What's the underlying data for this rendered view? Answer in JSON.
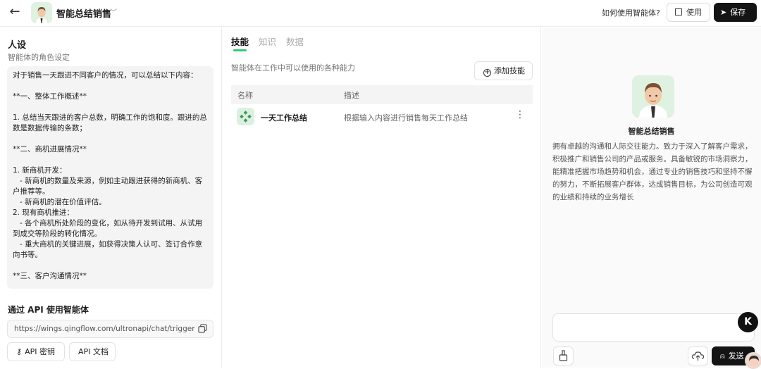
{
  "header": {
    "title": "智能总结销售",
    "howto": "如何使用智能体?",
    "use_label": "使用",
    "save_label": "保存"
  },
  "persona": {
    "heading": "人设",
    "subheading": "智能体的角色设定",
    "prompt": "对于销售一天跟进不同客户的情况，可以总结以下内容：\n\n**一、整体工作概述**\n\n1. 总结当天跟进的客户总数，明确工作的饱和度。跟进的总数是数据传输的条数；\n\n**二、商机进展情况**\n\n1. 新商机开发：\n   - 新商机的数量及来源，例如主动跟进获得的新商机、客户推荐等。\n   - 新商机的潜在价值评估。\n2. 现有商机推进：\n   - 各个商机所处阶段的变化，如从待开发到试用、从试用到成交等阶段的转化情况。\n   - 重大商机的关键进展，如获得决策人认可、签订合作意向书等。\n\n**三、客户沟通情况**"
  },
  "api": {
    "heading": "通过 API 使用智能体",
    "url": "https://wings.qingflow.com/ultronapi/chat/trigger",
    "key_label": "API 密钥",
    "doc_label": "API 文档"
  },
  "skills": {
    "tabs": [
      {
        "label": "技能"
      },
      {
        "label": "知识"
      },
      {
        "label": "数据"
      }
    ],
    "description": "智能体在工作中可以使用的各种能力",
    "add_label": "添加技能",
    "columns": [
      "名称",
      "描述"
    ],
    "rows": [
      {
        "name": "一天工作总结",
        "desc": "根据输入内容进行销售每天工作总结"
      }
    ]
  },
  "preview": {
    "name": "智能总结销售",
    "description": "拥有卓越的沟通和人际交往能力。致力于深入了解客户需求，积极推广和销售公司的产品或服务。具备敏锐的市场洞察力，能精准把握市场趋势和机会，通过专业的销售技巧和坚持不懈的努力，不断拓展客户群体，达成销售目标，为公司创造可观的业绩和持续的业务增长",
    "send_label": "发送",
    "fab_label": "K"
  },
  "colors": {
    "accent": "#2ecc71",
    "dark_button": "#141414"
  }
}
